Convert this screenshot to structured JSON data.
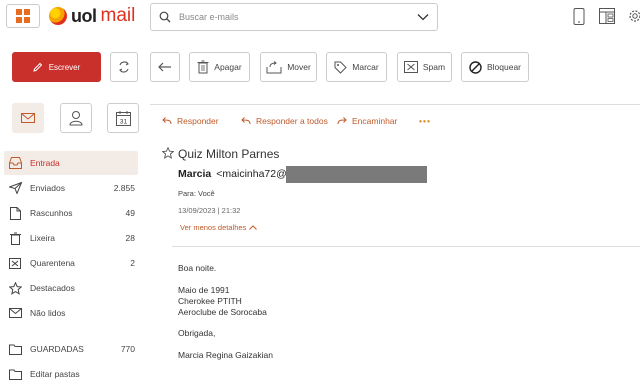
{
  "app": {
    "logo_text": "uol",
    "logo_suffix": "mail"
  },
  "search": {
    "placeholder": "Buscar e-mails"
  },
  "toolbar": {
    "compose": "Escrever",
    "delete": "Apagar",
    "move": "Mover",
    "mark": "Marcar",
    "spam": "Spam",
    "block": "Bloquear"
  },
  "sidebar": {
    "calendar_day": "31",
    "folders": [
      {
        "label": "Entrada",
        "count": ""
      },
      {
        "label": "Enviados",
        "count": "2.855"
      },
      {
        "label": "Rascunhos",
        "count": "49"
      },
      {
        "label": "Lixeira",
        "count": "28"
      },
      {
        "label": "Quarentena",
        "count": "2"
      },
      {
        "label": "Destacados",
        "count": ""
      },
      {
        "label": "Não lidos",
        "count": ""
      },
      {
        "label": "GUARDADAS",
        "count": "770"
      },
      {
        "label": "Editar pastas",
        "count": ""
      }
    ]
  },
  "message": {
    "actions": {
      "reply": "Responder",
      "reply_all": "Responder a todos",
      "forward": "Encaminhar",
      "more": "•••"
    },
    "subject": "Quiz Milton Parnes",
    "sender_name": "Marcia",
    "sender_email_prefix": "<maicinha72@",
    "to_label": "Para:",
    "to_value": "Você",
    "date": "13/09/2023 | 21:32",
    "details_link": "Ver menos detalhes",
    "body": [
      "Boa noite.",
      "Maio de 1991",
      "Cherokee PTITH",
      "Aeroclube de Sorocaba",
      "Obrigada,",
      "Marcia Regina Gaizakian"
    ]
  },
  "colors": {
    "accent": "#c9302c",
    "link": "#c05a2a",
    "active_bg": "#f3ebe6",
    "apps_icon": "#e86b1f"
  }
}
